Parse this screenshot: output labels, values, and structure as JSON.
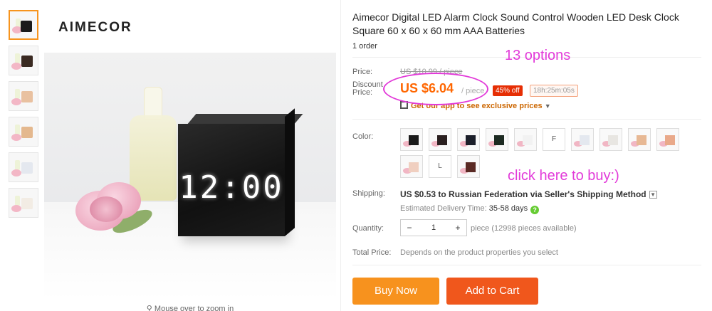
{
  "brand": "AIMECOR",
  "image": {
    "clock_time": "12:00",
    "zoom_hint": "Mouse over to zoom in"
  },
  "thumbnails": [
    {
      "name": "thumb-1",
      "clock_color": "#1b1b1b",
      "active": true
    },
    {
      "name": "thumb-2",
      "clock_color": "#3a2a22",
      "active": false
    },
    {
      "name": "thumb-3",
      "clock_color": "#e9c1a0",
      "active": false
    },
    {
      "name": "thumb-4",
      "clock_color": "#e4b88e",
      "active": false
    },
    {
      "name": "thumb-5",
      "clock_color": "#e4e8ef",
      "active": false
    },
    {
      "name": "thumb-6",
      "clock_color": "#f2ece4",
      "active": false
    }
  ],
  "product": {
    "title": "Aimecor Digital LED Alarm Clock Sound Control Wooden LED Desk Clock Square 60 x 60 x 60 mm AAA Batteries",
    "orders": "1 order"
  },
  "price": {
    "label": "Price:",
    "original": "US $10.99 / piece",
    "discount_label": "Discount Price:",
    "current": "US $6.04",
    "per_piece": "/ piece",
    "off_badge": "45% off",
    "timer": "18h:25m:05s",
    "app_promo": "Get our app to see exclusive prices"
  },
  "annotations": {
    "options": "13 options",
    "click_here": "click here to buy:)"
  },
  "color": {
    "label": "Color:",
    "swatches": [
      {
        "type": "img",
        "color": "#1b1b1b"
      },
      {
        "type": "img",
        "color": "#2a1f1f"
      },
      {
        "type": "img",
        "color": "#1c1f2a"
      },
      {
        "type": "img",
        "color": "#1d2b22"
      },
      {
        "type": "img",
        "color": "#f2f2f2"
      },
      {
        "type": "letter",
        "text": "F"
      },
      {
        "type": "img",
        "color": "#e4e8ef"
      },
      {
        "type": "img",
        "color": "#e8e6e2"
      },
      {
        "type": "img",
        "color": "#e7b894"
      },
      {
        "type": "img",
        "color": "#e9a98a"
      },
      {
        "type": "img",
        "color": "#f0cfc0"
      },
      {
        "type": "letter",
        "text": "L"
      },
      {
        "type": "img",
        "color": "#5a2a24"
      }
    ]
  },
  "shipping": {
    "label": "Shipping:",
    "main": "US $0.53 to Russian Federation via Seller's Shipping Method",
    "eta_label": "Estimated Delivery Time:",
    "eta_value": "35-58 days"
  },
  "quantity": {
    "label": "Quantity:",
    "minus": "−",
    "value": "1",
    "plus": "+",
    "note": "piece (12998 pieces available)"
  },
  "total": {
    "label": "Total Price:",
    "note": "Depends on the product properties you select"
  },
  "buttons": {
    "buy_now": "Buy Now",
    "add_to_cart": "Add to Cart"
  },
  "colors": {
    "accent_orange": "#f60",
    "buy_button": "#f7921e",
    "cart_button": "#f0571c",
    "annotation_magenta": "#e23ad9"
  }
}
